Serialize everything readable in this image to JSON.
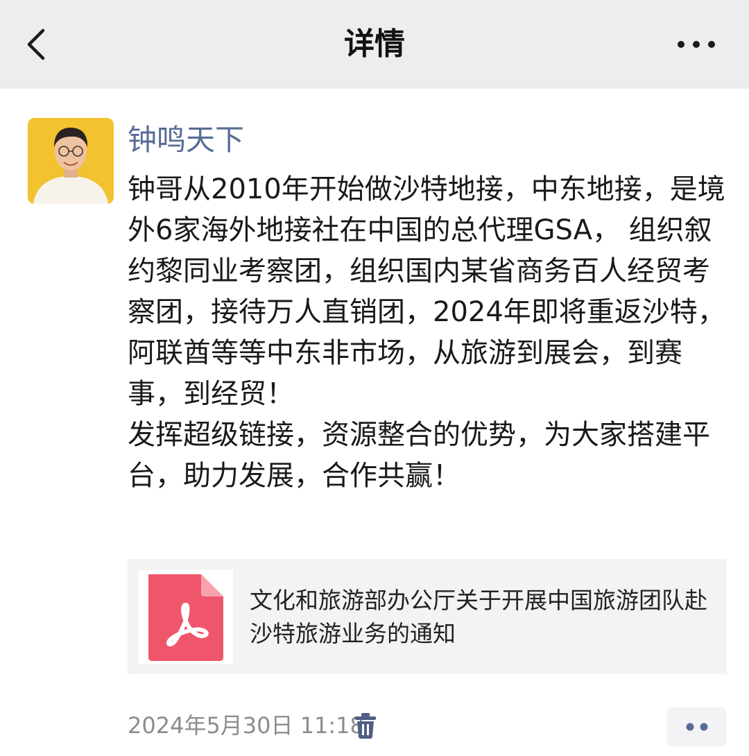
{
  "header": {
    "title": "详情",
    "back_icon": "chevron-left-icon",
    "more_icon": "more-horizontal-icon"
  },
  "post": {
    "author": "钟鸣天下",
    "paragraphs": [
      "钟哥从2010年开始做沙特地接，中东地接，是境外6家海外地接社在中国的总代理GSA， 组织叙约黎同业考察团，组织国内某省商务百人经贸考察团，接待万人直销团，2024年即将重返沙特，阿联酋等等中东非市场，从旅游到展会，到赛事，到经贸！",
      "发挥超级链接，资源整合的优势，为大家搭建平台，助力发展，合作共赢！"
    ],
    "attachment": {
      "icon": "pdf-icon",
      "title": "文化和旅游部办公厅关于开展中国旅游团队赴沙特旅游业务的通知"
    },
    "timestamp": "2024年5月30日 11:18",
    "delete_icon": "trash-icon",
    "action_icon": "more-dots-icon"
  },
  "colors": {
    "header_bg": "#ededed",
    "author_name": "#576b95",
    "pdf_red": "#f0566b",
    "meta_gray": "#8c8c8c",
    "trash_blue": "#4f5e84"
  }
}
